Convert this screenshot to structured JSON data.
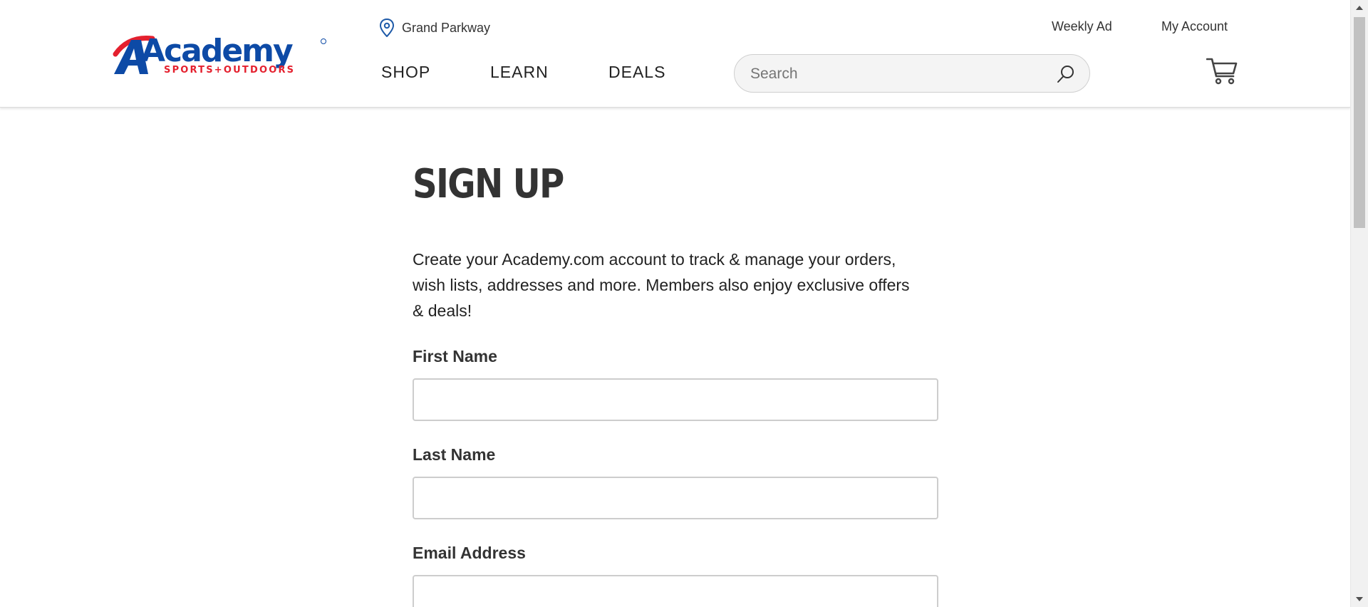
{
  "header": {
    "logo": {
      "brand": "Academy",
      "tagline": "SPORTS+OUTDOORS",
      "colors": {
        "blue": "#0d4aa6",
        "red": "#e4202e"
      }
    },
    "location": {
      "icon": "map-pin-icon",
      "label": "Grand Parkway"
    },
    "top_links": {
      "weekly_ad": "Weekly Ad",
      "my_account": "My Account"
    },
    "nav": {
      "shop": "SHOP",
      "learn": "LEARN",
      "deals": "DEALS"
    },
    "search": {
      "placeholder": "Search",
      "value": "",
      "icon": "search-icon"
    },
    "cart": {
      "icon": "cart-icon"
    }
  },
  "main": {
    "title": "SIGN UP",
    "intro": "Create your Academy.com account to track & manage your orders, wish lists, addresses and more. Members also enjoy exclusive offers & deals!",
    "fields": {
      "first_name": {
        "label": "First Name",
        "value": ""
      },
      "last_name": {
        "label": "Last Name",
        "value": ""
      },
      "email": {
        "label": "Email Address",
        "value": ""
      }
    }
  },
  "colors": {
    "text": "#333333",
    "search_bg": "#f4f4f4",
    "border": "#cdcdcd"
  }
}
